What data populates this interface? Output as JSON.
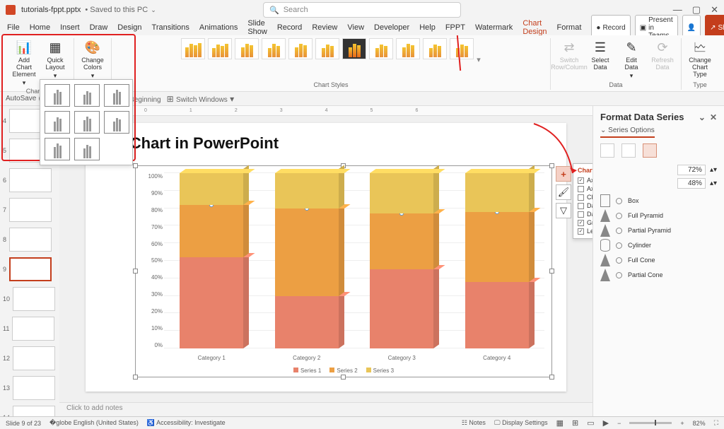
{
  "titlebar": {
    "filename": "tutorials-fppt.pptx",
    "saved": "• Saved to this PC",
    "search_placeholder": "Search"
  },
  "tabs": [
    "File",
    "Home",
    "Insert",
    "Draw",
    "Design",
    "Transitions",
    "Animations",
    "Slide Show",
    "Record",
    "Review",
    "View",
    "Developer",
    "Help",
    "FPPT",
    "Watermark",
    "Chart Design",
    "Format"
  ],
  "active_tab": "Chart Design",
  "topright": {
    "record": "Record",
    "present": "Present in Teams",
    "share": "Share"
  },
  "ribbon": {
    "add_element": "Add Chart Element",
    "quick_layout": "Quick Layout",
    "change_colors": "Change Colors",
    "chart_layouts_label": "Chart L…",
    "chart_styles_label": "Chart Styles",
    "switch": "Switch Row/Column",
    "select_data": "Select Data",
    "edit_data": "Edit Data",
    "refresh_data": "Refresh Data",
    "data_label": "Data",
    "change_type": "Change Chart Type",
    "type_label": "Type"
  },
  "qat": {
    "autosave": "AutoSave",
    "from_beginning": "From Beginning",
    "switch_windows": "Switch Windows"
  },
  "thumbs": {
    "sel_index": 9,
    "visible": [
      4,
      5,
      6,
      7,
      8,
      9,
      10,
      11,
      12,
      13,
      14
    ]
  },
  "slide": {
    "title": "Bar Chart in PowerPoint",
    "notes_placeholder": "Click to add notes"
  },
  "chart_data": {
    "type": "bar",
    "stacked_percent": true,
    "categories": [
      "Category 1",
      "Category 2",
      "Category 3",
      "Category 4"
    ],
    "series": [
      {
        "name": "Series 1",
        "values": [
          52,
          30,
          45,
          38
        ],
        "color": "#e8826b"
      },
      {
        "name": "Series 2",
        "values": [
          30,
          50,
          32,
          40
        ],
        "color": "#ec9f43"
      },
      {
        "name": "Series 3",
        "values": [
          18,
          20,
          23,
          22
        ],
        "color": "#e9c558"
      }
    ],
    "ylabels": [
      "0%",
      "10%",
      "20%",
      "30%",
      "40%",
      "50%",
      "60%",
      "70%",
      "80%",
      "90%",
      "100%"
    ],
    "ylim": [
      0,
      100
    ]
  },
  "chart_elements": {
    "title": "Chart Elements",
    "items": [
      {
        "label": "Axes",
        "checked": true
      },
      {
        "label": "Axis Titles",
        "checked": false
      },
      {
        "label": "Chart Title",
        "checked": false
      },
      {
        "label": "Data Labels",
        "checked": false
      },
      {
        "label": "Data Table",
        "checked": false
      },
      {
        "label": "Gridlines",
        "checked": true
      },
      {
        "label": "Legend",
        "checked": true
      }
    ]
  },
  "format_pane": {
    "title": "Format Data Series",
    "section": "Series Options",
    "gap_depth": "72%",
    "gap_width": "48%",
    "shapes": [
      "Box",
      "Full Pyramid",
      "Partial Pyramid",
      "Cylinder",
      "Full Cone",
      "Partial Cone"
    ]
  },
  "status": {
    "slide_of": "Slide 9 of 23",
    "lang": "English (United States)",
    "access": "Accessibility: Investigate",
    "notes": "Notes",
    "display": "Display Settings",
    "zoom": "82%"
  }
}
